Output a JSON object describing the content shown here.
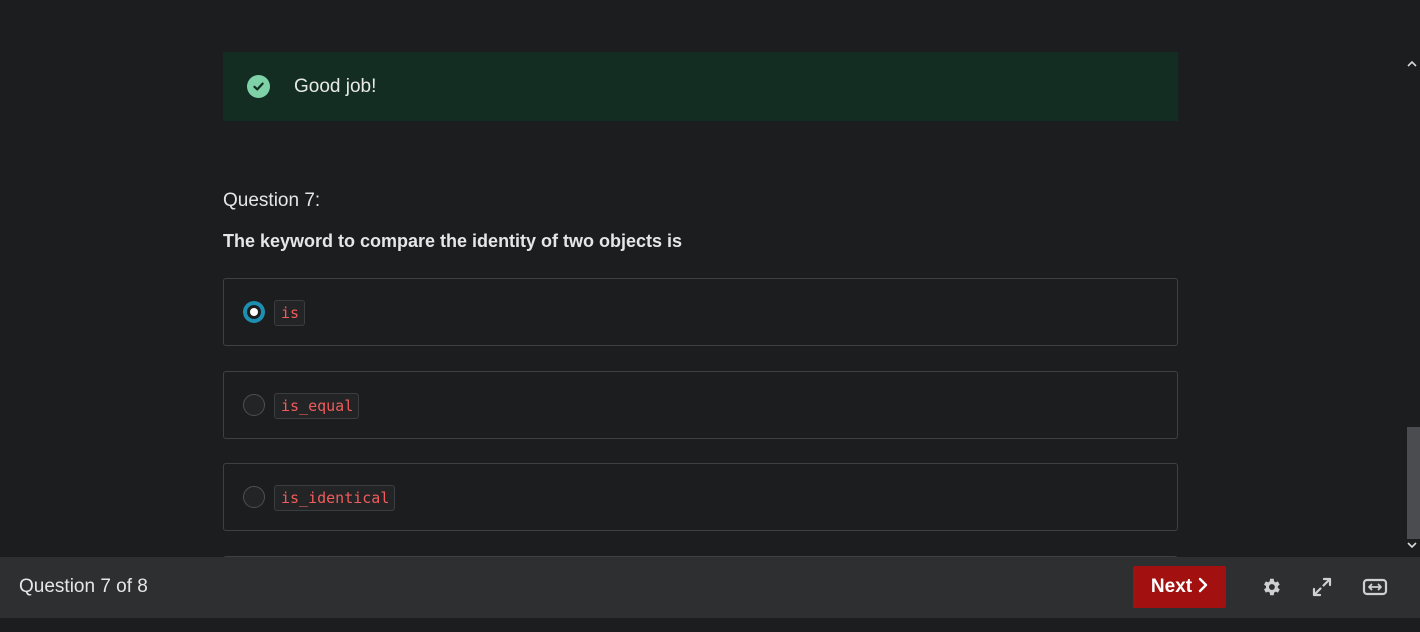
{
  "feedback": {
    "message": "Good job!"
  },
  "question": {
    "label": "Question 7:",
    "text": "The keyword to compare the identity of two objects is",
    "options": [
      {
        "code": "is",
        "selected": true
      },
      {
        "code": "is_equal",
        "selected": false
      },
      {
        "code": "is_identical",
        "selected": false
      }
    ]
  },
  "footer": {
    "counter": "Question 7 of 8",
    "next_label": "Next"
  },
  "colors": {
    "success_bg": "#132d23",
    "success_icon": "#7fd2a8",
    "radio_selected": "#1e8fb0",
    "code_text": "#f15b5b",
    "next_button": "#a31010"
  },
  "icons": {
    "feedback": "check-circle-icon",
    "next": "chevron-right-icon",
    "settings": "gear-icon",
    "fullscreen": "expand-icon",
    "wide_view": "expand-horizontal-icon"
  }
}
